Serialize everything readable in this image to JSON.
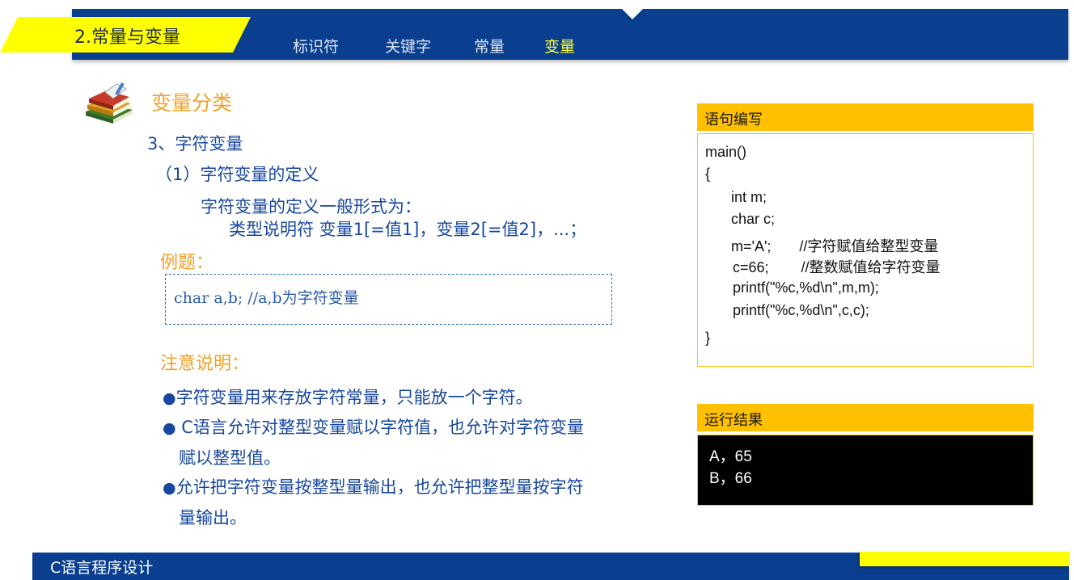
{
  "header": {
    "section_title": "2.常量与变量",
    "nav": [
      "标识符",
      "关键字",
      "常量",
      "变量"
    ],
    "active_nav": "变量",
    "colors": {
      "bar": "#0a3f8f",
      "accent": "#ffff00",
      "active_text": "#ffff3a"
    }
  },
  "content": {
    "heading": "变量分类",
    "sub1": "3、字符变量",
    "sub2": "（1）字符变量的定义",
    "def_line1": "字符变量的定义一般形式为：",
    "def_line2": "类型说明符 变量1[=值1]，变量2[=值2]，...；",
    "example_label": "例题：",
    "example_code": "char  a,b;  //a,b为字符变量",
    "note_label": "注意说明：",
    "bullets": [
      {
        "line1": "字符变量用来存放字符常量，只能放一个字符。",
        "line2": ""
      },
      {
        "line1": "C语言允许对整型变量赋以字符值，也允许对字符变量",
        "line2": "赋以整型值。"
      },
      {
        "line1": "允许把字符变量按整型量输出，也允许把整型量按字符",
        "line2": "量输出。"
      }
    ],
    "bullet_marker": "●",
    "icon": "books-icon"
  },
  "code_panel": {
    "title": "语句编写",
    "lines": [
      "main()",
      "{",
      "int m;",
      "char c;",
      "m='A';       //字符赋值给整型变量",
      "c=66;        //整数赋值给字符变量",
      "printf(\"%c,%d\\n\",m,m);",
      "printf(\"%c,%d\\n\",c,c);",
      "}"
    ]
  },
  "result_panel": {
    "title": "运行结果",
    "lines": [
      "A，65",
      "B，66"
    ]
  },
  "footer": {
    "title": "C语言程序设计"
  }
}
